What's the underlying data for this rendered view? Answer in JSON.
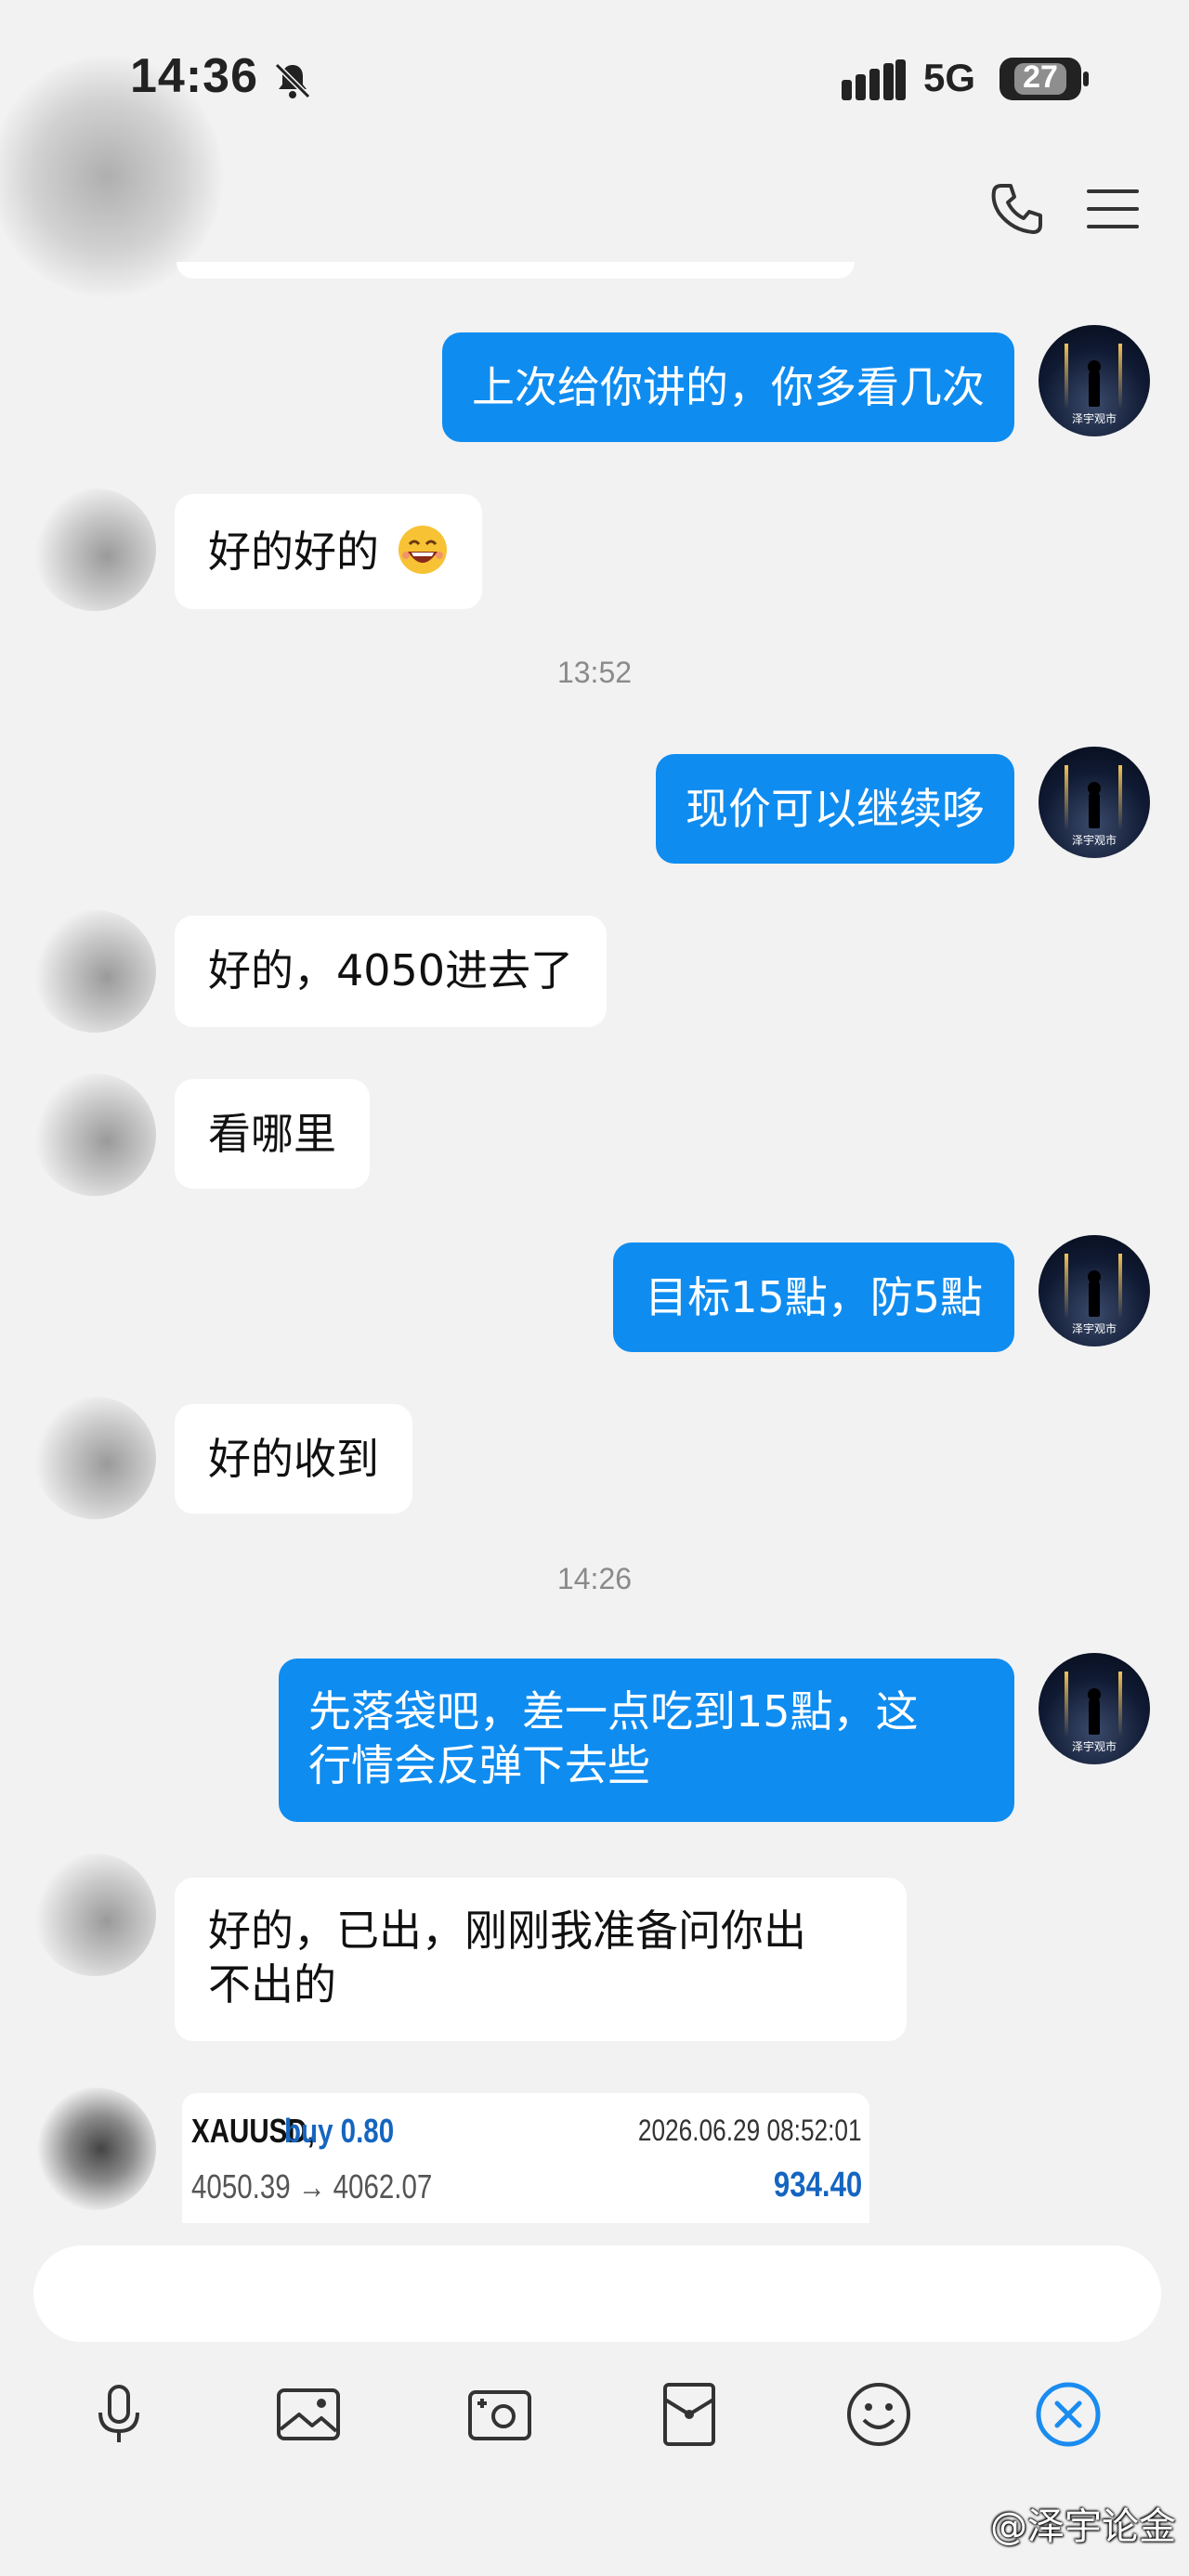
{
  "status_bar": {
    "time": "14:36",
    "network": "5G",
    "battery": "27"
  },
  "timestamps": {
    "t1": "13:52",
    "t2": "14:26"
  },
  "messages": [
    {
      "side": "right",
      "text": "上次给你讲的，你多看几次"
    },
    {
      "side": "left",
      "text": "好的好的"
    },
    {
      "side": "right",
      "text": "现价可以继续哆"
    },
    {
      "side": "left",
      "text": "好的，4050进去了"
    },
    {
      "side": "left",
      "text": "看哪里"
    },
    {
      "side": "right",
      "text": "目标15點，防5點"
    },
    {
      "side": "left",
      "text": "好的收到"
    },
    {
      "side": "right",
      "text_line1": "先落袋吧，差一点吃到15點，这",
      "text_line2": "行情会反弹下去些"
    },
    {
      "side": "left",
      "text_line1": "好的，已出，刚刚我准备问你出",
      "text_line2": "不出的"
    }
  ],
  "trade_card": {
    "symbol": "XAUUSD,",
    "direction": "buy 0.80",
    "datetime": "2026.06.29 08:52:01",
    "prices": "4050.39 → 4062.07",
    "profit": "934.40"
  },
  "avatar_caption": "泽宇观市",
  "watermark": "@泽宇论金",
  "colors": {
    "bubble_out": "#0f8cf0",
    "bubble_in": "#ffffff",
    "background": "#f2f2f2",
    "accent_blue": "#1a8cf0"
  },
  "icons": [
    "bell-mute-icon",
    "signal-icon",
    "phone-icon",
    "menu-icon",
    "smiling-emoji-icon",
    "microphone-icon",
    "image-icon",
    "camera-icon",
    "red-packet-icon",
    "emoji-icon",
    "close-circle-icon"
  ]
}
